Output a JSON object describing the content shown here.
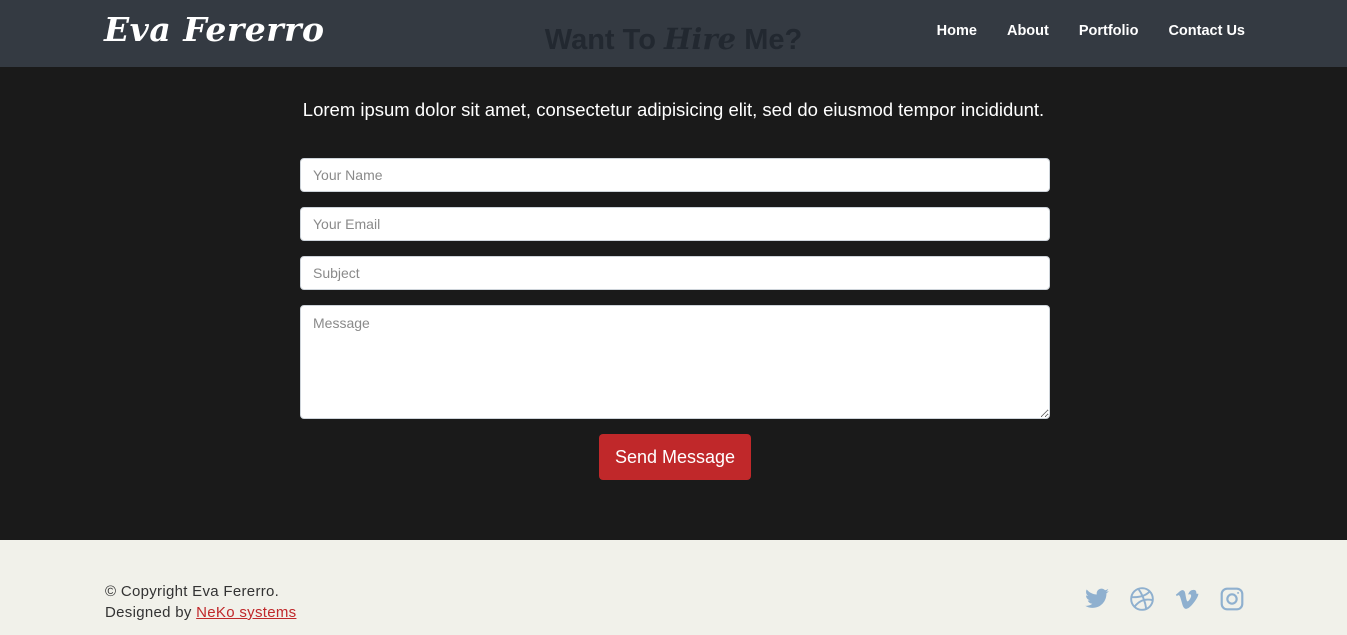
{
  "header": {
    "brand": "Eva Fererro",
    "ghost_heading": {
      "prefix": "Want To ",
      "accent": "Hire",
      "suffix": " Me?"
    },
    "nav": [
      {
        "label": "Home"
      },
      {
        "label": "About"
      },
      {
        "label": "Portfolio"
      },
      {
        "label": "Contact Us"
      }
    ]
  },
  "contact": {
    "lead": "Lorem ipsum dolor sit amet, consectetur adipisicing elit, sed do eiusmod tempor incididunt.",
    "name_placeholder": "Your Name",
    "email_placeholder": "Your Email",
    "subject_placeholder": "Subject",
    "message_placeholder": "Message",
    "send_label": "Send Message"
  },
  "footer": {
    "copyright": "© Copyright Eva Fererro.",
    "designed_by": "Designed by ",
    "designer": "NeKo systems",
    "social_icons": [
      "twitter-icon",
      "dribbble-icon",
      "vimeo-icon",
      "instagram-icon"
    ],
    "social_color": "#8fb0cf"
  },
  "colors": {
    "navbar": "#343a42",
    "body": "#1a1a1a",
    "accent": "#c0282a",
    "footer": "#f1f1ea"
  }
}
